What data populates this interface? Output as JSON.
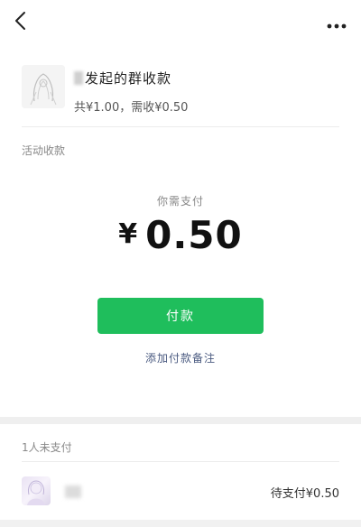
{
  "topbar": {
    "back_icon": "chevron-left-icon",
    "more_icon": "more-horizontal-icon"
  },
  "header": {
    "title": "发起的群收款",
    "summary": "共¥1.00，需收¥0.50"
  },
  "activity": {
    "label": "活动收款"
  },
  "payment": {
    "subtitle": "你需支付",
    "currency": "¥",
    "amount": "0.50",
    "pay_button": "付款",
    "add_note": "添加付款备注"
  },
  "unpaid": {
    "label": "1人未支付",
    "rows": [
      {
        "status": "待支付¥0.50"
      }
    ]
  },
  "colors": {
    "accent": "#1fbe5c",
    "link": "#4a5a80",
    "band": "#efefef"
  }
}
